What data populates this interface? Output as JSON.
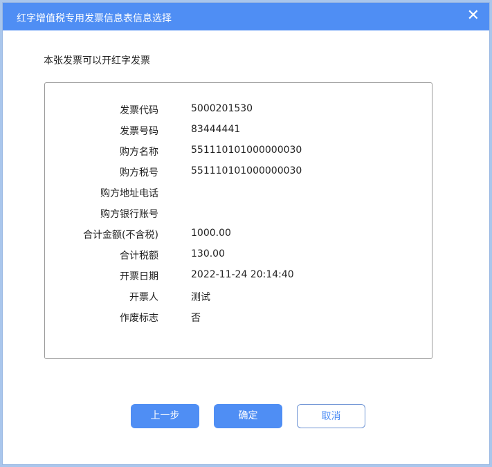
{
  "dialog": {
    "title": "红字增值税专用发票信息表信息选择",
    "close_icon": "close-icon",
    "notice": "本张发票可以开红字发票",
    "fields": [
      {
        "label": "发票代码",
        "value": "5000201530"
      },
      {
        "label": "发票号码",
        "value": "83444441"
      },
      {
        "label": "购方名称",
        "value": "551110101000000030"
      },
      {
        "label": "购方税号",
        "value": "551110101000000030"
      },
      {
        "label": "购方地址电话",
        "value": ""
      },
      {
        "label": "购方银行账号",
        "value": ""
      },
      {
        "label": "合计金额(不含税)",
        "value": "1000.00"
      },
      {
        "label": "合计税额",
        "value": "130.00"
      },
      {
        "label": "开票日期",
        "value": "2022-11-24 20:14:40"
      },
      {
        "label": "开票人",
        "value": "测试"
      },
      {
        "label": "作废标志",
        "value": "否"
      }
    ],
    "buttons": {
      "prev": "上一步",
      "confirm": "确定",
      "cancel": "取消"
    },
    "accent": "#4f8ef4"
  }
}
